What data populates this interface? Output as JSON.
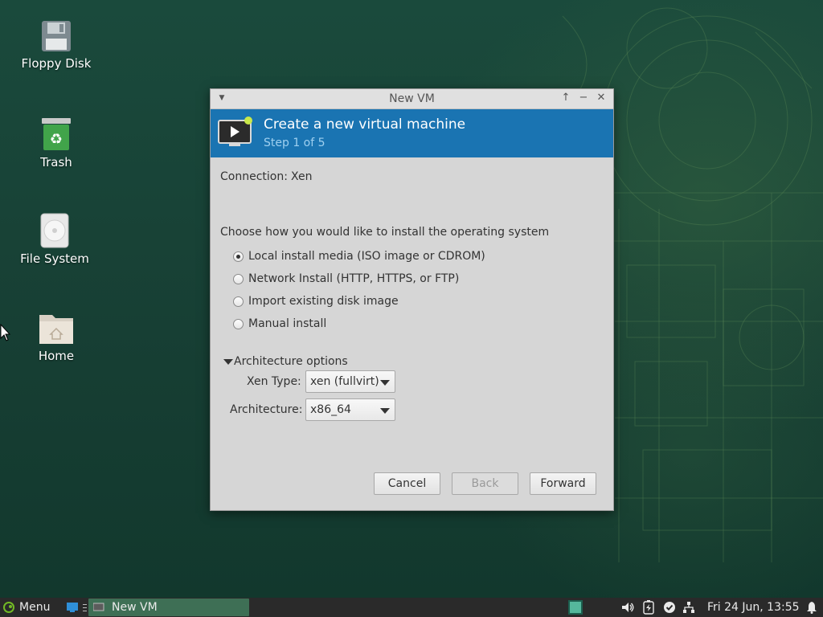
{
  "desktop": {
    "icons": [
      {
        "label": "Floppy Disk",
        "icon": "floppy-disk-icon"
      },
      {
        "label": "Trash",
        "icon": "trash-icon"
      },
      {
        "label": "File System",
        "icon": "drive-icon"
      },
      {
        "label": "Home",
        "icon": "home-folder-icon"
      }
    ]
  },
  "dialog": {
    "window_title": "New VM",
    "banner": {
      "heading": "Create a new virtual machine",
      "step": "Step 1 of 5"
    },
    "connection_label": "Connection:",
    "connection_value": "Xen",
    "prompt": "Choose how you would like to install the operating system",
    "install_options": [
      {
        "label": "Local install media (ISO image or CDROM)",
        "selected": true
      },
      {
        "label": "Network Install (HTTP, HTTPS, or FTP)",
        "selected": false
      },
      {
        "label": "Import existing disk image",
        "selected": false
      },
      {
        "label": "Manual install",
        "selected": false
      }
    ],
    "arch_section_label": "Architecture options",
    "xen_type_label": "Xen Type:",
    "xen_type_value": "xen (fullvirt)",
    "architecture_label": "Architecture:",
    "architecture_value": "x86_64",
    "buttons": {
      "cancel": "Cancel",
      "back": "Back",
      "forward": "Forward"
    }
  },
  "taskbar": {
    "menu_label": "Menu",
    "task_label": "New VM",
    "clock": "Fri 24 Jun, 13:55"
  },
  "colors": {
    "banner": "#1a74b2",
    "desktop": "#173f34",
    "task_active": "#3e6f55"
  }
}
